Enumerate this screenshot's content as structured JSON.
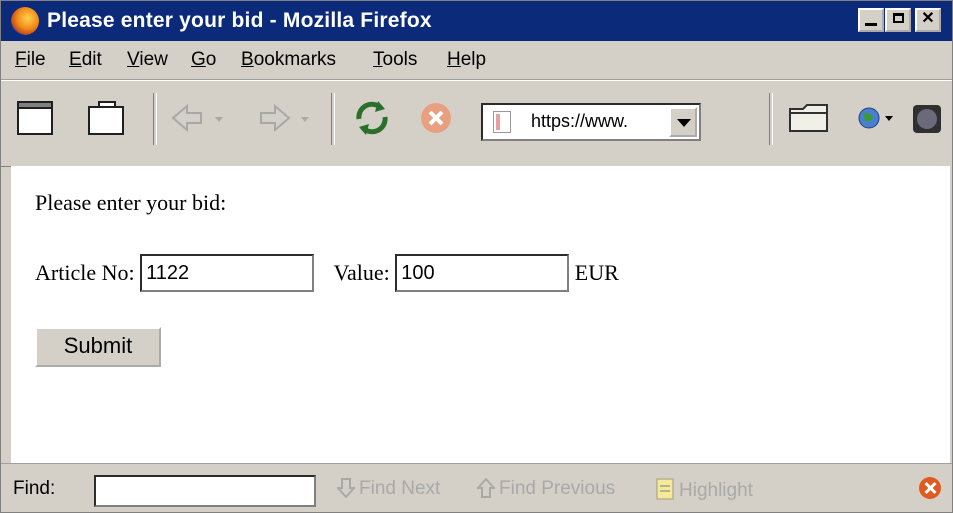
{
  "window": {
    "title": "Please enter your bid - Mozilla Firefox"
  },
  "menu": {
    "items": [
      {
        "accel": "F",
        "rest": "ile"
      },
      {
        "accel": "E",
        "rest": "dit"
      },
      {
        "accel": "V",
        "rest": "iew"
      },
      {
        "accel": "G",
        "rest": "o"
      },
      {
        "accel": "B",
        "rest": "ookmarks"
      },
      {
        "accel": "T",
        "rest": "ools"
      },
      {
        "accel": "H",
        "rest": "elp"
      }
    ]
  },
  "toolbar": {
    "url": "https://www."
  },
  "page": {
    "prompt": "Please enter your bid:",
    "article_label": "Article No:",
    "article_value": "1122",
    "value_label": "Value:",
    "value_value": "100",
    "currency": "EUR",
    "submit_label": "Submit"
  },
  "findbar": {
    "label": "Find:",
    "value": "",
    "find_next": "Find Next",
    "find_previous": "Find Previous",
    "highlight": "Highlight"
  }
}
